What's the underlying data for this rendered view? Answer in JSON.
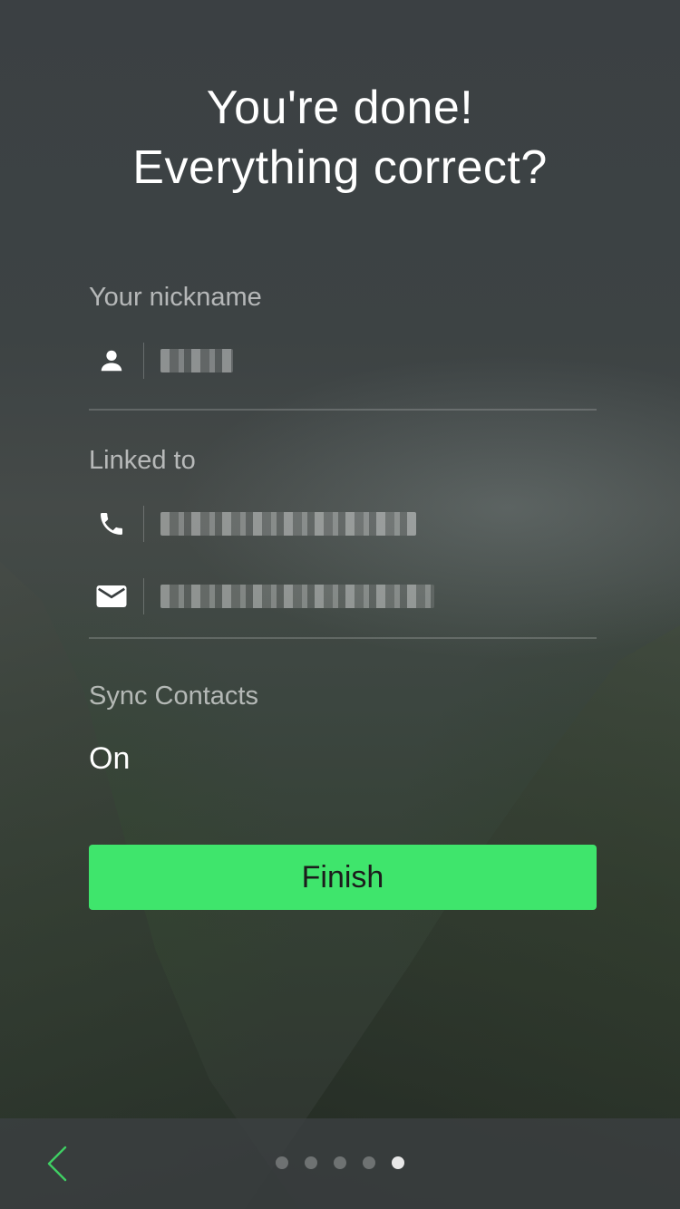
{
  "header": {
    "title_line1": "You're done!",
    "title_line2": "Everything correct?"
  },
  "nickname": {
    "label": "Your nickname",
    "value": "●●●●",
    "icon": "person-icon"
  },
  "linked": {
    "label": "Linked to",
    "phone": {
      "icon": "phone-icon",
      "value": "●●●●●●● ●●●●●●●"
    },
    "email": {
      "icon": "mail-icon",
      "value": "●●●●●●●●●●●●●●●●●●"
    }
  },
  "sync": {
    "label": "Sync Contacts",
    "value": "On"
  },
  "actions": {
    "finish_label": "Finish"
  },
  "footer": {
    "back_icon": "chevron-left-icon",
    "pages_total": 5,
    "current_page": 5
  },
  "colors": {
    "accent": "#3fe56c",
    "back_chevron": "#3fcf63"
  }
}
